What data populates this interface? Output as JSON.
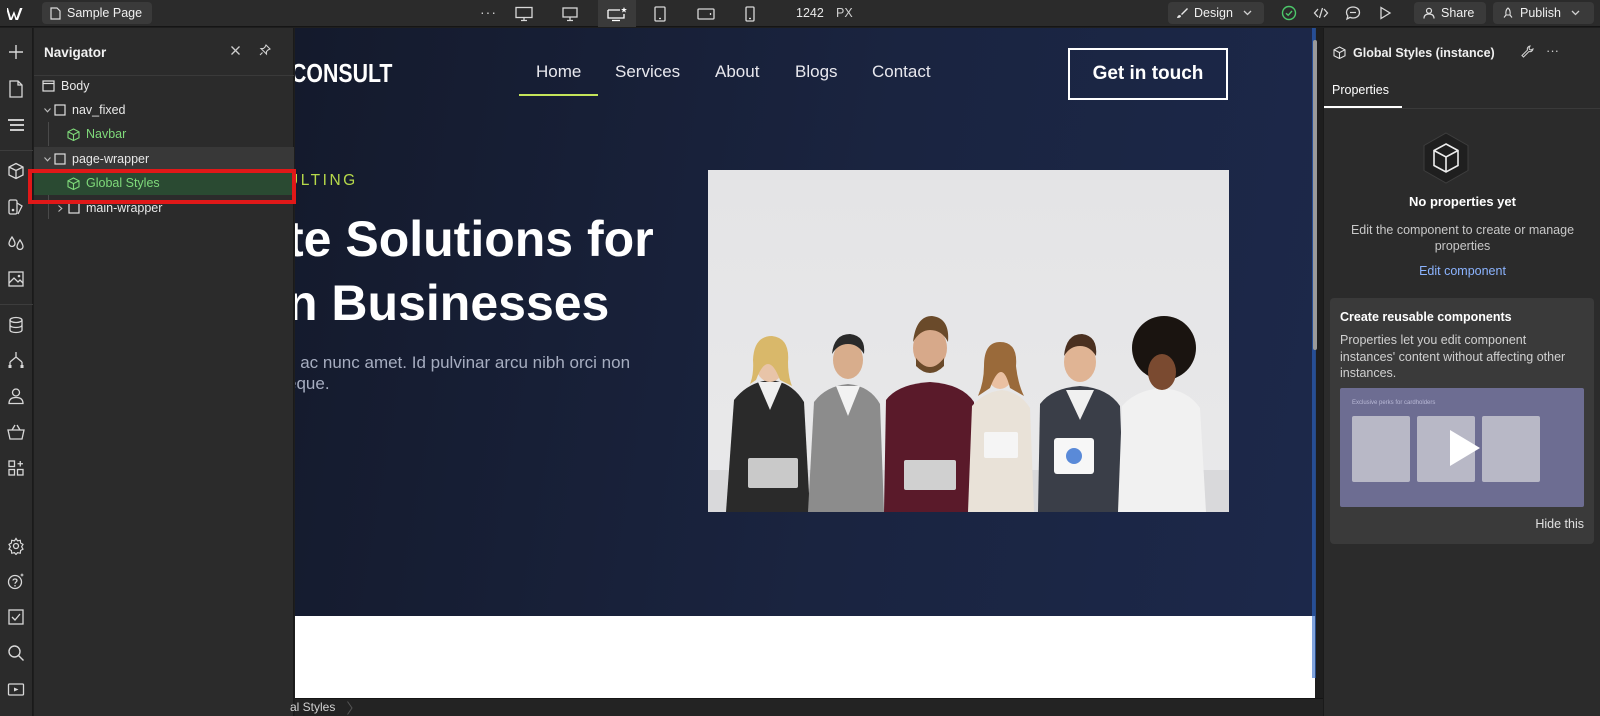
{
  "topbar": {
    "page_name": "Sample Page",
    "more": "···",
    "width_value": "1242",
    "width_unit": "PX",
    "design_label": "Design",
    "share_label": "Share",
    "publish_label": "Publish"
  },
  "navigator": {
    "title": "Navigator",
    "tree": [
      {
        "label": "Body"
      },
      {
        "label": "nav_fixed"
      },
      {
        "label": "Navbar"
      },
      {
        "label": "page-wrapper"
      },
      {
        "label": "Global Styles"
      },
      {
        "label": "main-wrapper"
      }
    ]
  },
  "canvas": {
    "logo": "CONSULT",
    "menu": [
      "Home",
      "Services",
      "About",
      "Blogs",
      "Contact"
    ],
    "cta": "Get in touch",
    "eyebrow": "ULTING",
    "heading_lines": [
      "te Solutions for",
      "n Businesses"
    ],
    "para_lines": [
      "s ac nunc amet. Id pulvinar arcu nibh orci non",
      "eque."
    ]
  },
  "breadcrumb": {
    "label": "al Styles"
  },
  "right_panel": {
    "title": "Global Styles (instance)",
    "tab": "Properties",
    "empty_title": "No properties yet",
    "empty_desc": "Edit the component to create or manage properties",
    "edit_link": "Edit component",
    "card_title": "Create reusable components",
    "card_desc": "Properties let you edit component instances' content without affecting other instances.",
    "video_caption": "Exclusive perks for cardholders",
    "hide_label": "Hide this"
  },
  "colors": {
    "accent_green": "#c4e45a",
    "selection_green": "#2a4a32",
    "highlight_red": "#e01818",
    "link_blue": "#8cb4ff"
  },
  "icons": {
    "rail": [
      "add-icon",
      "pages-icon",
      "navigator-icon",
      "components-icon",
      "variables-icon",
      "styles-icon",
      "assets-icon",
      "cms-icon",
      "logic-icon",
      "users-icon",
      "ecommerce-icon",
      "apps-icon",
      "settings-icon",
      "help-icon",
      "audit-icon",
      "search-icon",
      "video-icon"
    ]
  }
}
